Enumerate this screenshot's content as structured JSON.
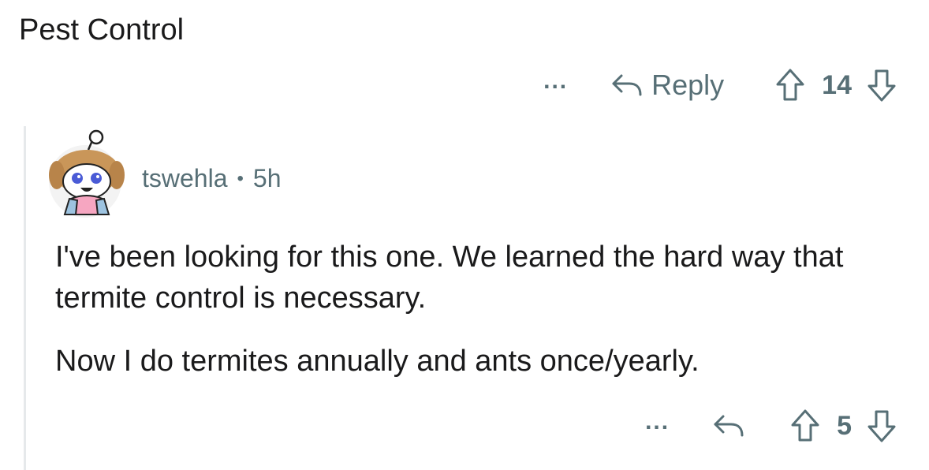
{
  "parent": {
    "text": "Pest Control",
    "actions": {
      "more_label": "...",
      "reply_label": "Reply",
      "score": "14"
    }
  },
  "comment": {
    "username": "tswehla",
    "separator": "•",
    "age": "5h",
    "paragraphs": [
      "I've been looking for this one. We learned the hard way that termite control is necessary.",
      "Now I do termites annually and ants once/yearly."
    ],
    "actions": {
      "more_label": "...",
      "score": "5"
    }
  },
  "icons": {
    "more": "more-icon",
    "reply": "reply-arrow-icon",
    "upvote": "upvote-arrow-icon",
    "downvote": "downvote-arrow-icon",
    "avatar": "snoo-avatar-icon"
  },
  "colors": {
    "text": "#1a1a1b",
    "muted": "#576f76",
    "thread_line": "#e6e9eb"
  }
}
